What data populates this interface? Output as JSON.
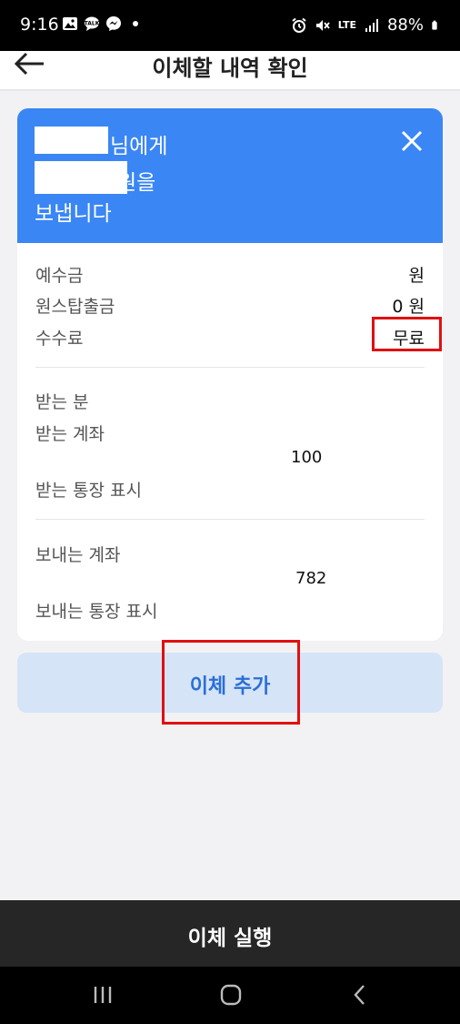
{
  "status_bar": {
    "time": "9:16",
    "network": "LTE",
    "battery": "88%"
  },
  "app_bar": {
    "title": "이체할 내역 확인"
  },
  "header": {
    "line1_suffix": "님에게",
    "line2_suffix": "원을",
    "line3": "보냅니다",
    "background_color": "#3a86f4"
  },
  "summary": {
    "deposit_label": "예수금",
    "deposit_value": "원",
    "onestop_label": "원스탑출금",
    "onestop_value": "0 원",
    "fee_label": "수수료",
    "fee_value": "무료"
  },
  "recipient": {
    "name_label": "받는 분",
    "account_label": "받는 계좌",
    "account_value": "100",
    "display_label": "받는 통장 표시"
  },
  "sender": {
    "account_label": "보내는 계좌",
    "account_value": "782",
    "display_label": "보내는 통장 표시"
  },
  "buttons": {
    "add_transfer": "이체 추가",
    "execute_transfer": "이체 실행"
  },
  "colors": {
    "accent": "#3a86f4",
    "highlight": "#e01010",
    "add_button_bg": "#d6e4f8",
    "add_button_text": "#2a6fd6"
  }
}
